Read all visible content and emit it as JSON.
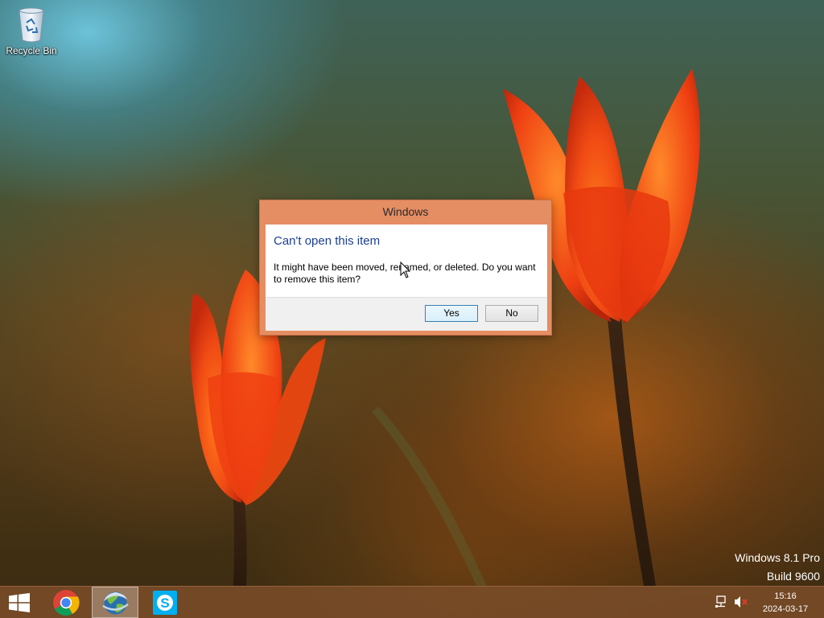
{
  "desktop": {
    "icons": [
      {
        "label": "Recycle Bin",
        "icon": "recycle-bin-icon"
      }
    ]
  },
  "dialog": {
    "title": "Windows",
    "heading": "Can't open this item",
    "message": "It might have been moved, renamed, or deleted. Do you want to remove this item?",
    "buttons": {
      "yes": "Yes",
      "no": "No"
    },
    "accent_color": "#e58d63",
    "heading_color": "#1c3f95"
  },
  "watermark": {
    "line1": "Windows 8.1 Pro",
    "line2": "Build 9600"
  },
  "taskbar": {
    "start_icon": "windows-logo-icon",
    "pinned": [
      {
        "name": "chrome",
        "icon": "chrome-icon"
      },
      {
        "name": "app",
        "icon": "globe-app-icon",
        "active": true
      },
      {
        "name": "skype",
        "icon": "skype-icon"
      }
    ],
    "tray": {
      "network_icon": "network-icon",
      "volume_icon": "volume-muted-icon",
      "time": "15:16",
      "date": "2024-03-17"
    },
    "color": "#7a4c28"
  }
}
